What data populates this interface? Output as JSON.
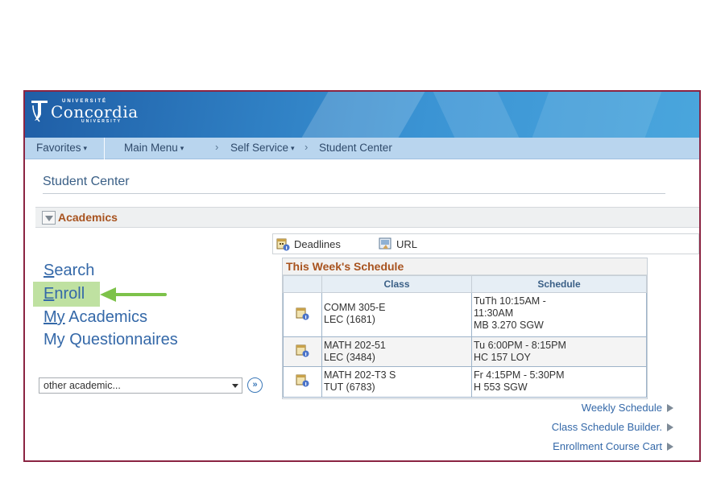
{
  "logo": {
    "top": "UNIVERSITÉ",
    "main": "Concordia",
    "bottom": "UNIVERSITY"
  },
  "nav": {
    "favorites": "Favorites",
    "main_menu": "Main Menu",
    "self_service": "Self Service",
    "student_center": "Student Center",
    "separator": "›",
    "caret": "▾"
  },
  "page": {
    "title": "Student Center"
  },
  "section": {
    "title": "Academics"
  },
  "left_links": {
    "search_first": "S",
    "search_rest": "earch",
    "enroll_first": "E",
    "enroll_rest": "nroll",
    "academics_first": "My",
    "academics_rest": " Academics",
    "questionnaires": "My Questionnaires"
  },
  "other_select": {
    "value": "other academic...",
    "go": "»"
  },
  "quick_links": {
    "deadlines": "Deadlines",
    "url": "URL"
  },
  "schedule": {
    "title": "This Week's Schedule",
    "headers": {
      "class": "Class",
      "schedule": "Schedule"
    },
    "rows": [
      {
        "class_line1": "COMM 305-E",
        "class_line2": "LEC (1681)",
        "sched_line1": "TuTh 10:15AM -",
        "sched_line2": "11:30AM",
        "sched_line3": "MB 3.270 SGW"
      },
      {
        "class_line1": "MATH 202-51",
        "class_line2": "LEC (3484)",
        "sched_line1": "Tu 6:00PM - 8:15PM",
        "sched_line2": "HC 157 LOY",
        "sched_line3": ""
      },
      {
        "class_line1": "MATH 202-T3 S",
        "class_line2": "TUT (6783)",
        "sched_line1": "Fr 4:15PM - 5:30PM",
        "sched_line2": "H 553 SGW",
        "sched_line3": ""
      }
    ]
  },
  "bottom_links": {
    "weekly": "Weekly Schedule",
    "builder": "Class Schedule Builder.",
    "cart": "Enrollment Course Cart"
  },
  "colors": {
    "accent": "#a8531f",
    "link": "#3468a8",
    "frame": "#8b2442",
    "highlight": "#bfe1a1",
    "arrow": "#7dc24a"
  }
}
